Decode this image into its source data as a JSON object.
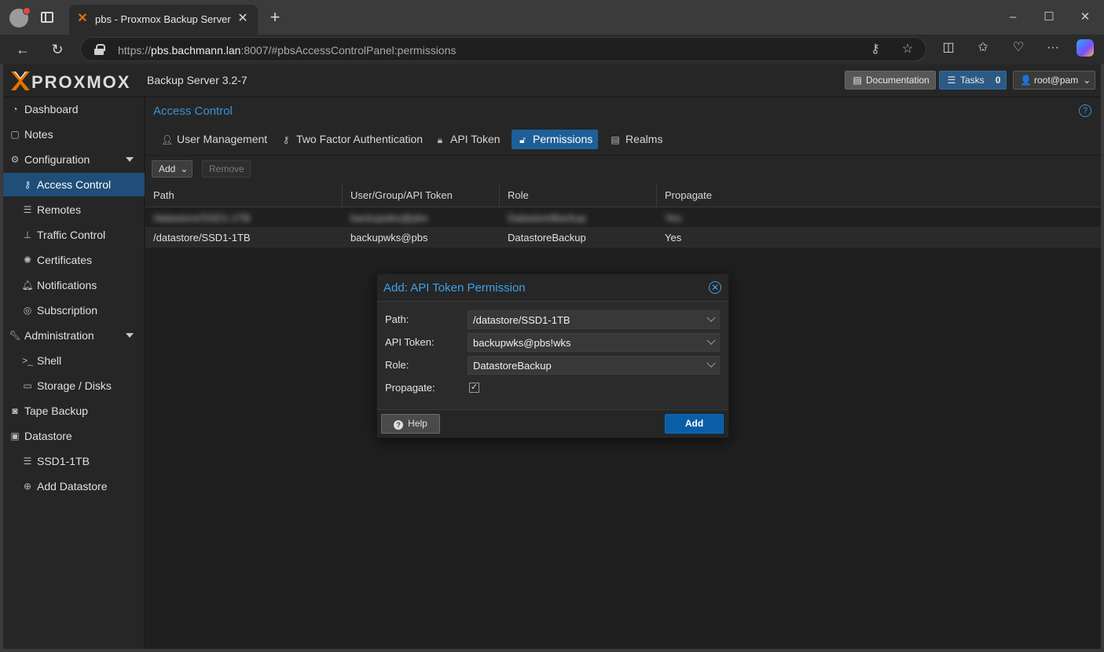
{
  "browser": {
    "tab_title": "pbs - Proxmox Backup Server",
    "url_prefix": "https://",
    "url_host": "pbs.bachmann.lan",
    "url_rest": ":8007/#pbsAccessControlPanel:permissions"
  },
  "header": {
    "logo_text": "PROXMOX",
    "product": "Backup Server 3.2-7",
    "documentation_label": "Documentation",
    "tasks_label": "Tasks",
    "tasks_count": "0",
    "user_label": "root@pam"
  },
  "sidebar": {
    "items": [
      {
        "label": "Dashboard",
        "icon": "dashboard-icon"
      },
      {
        "label": "Notes",
        "icon": "notes-icon"
      },
      {
        "label": "Configuration",
        "icon": "gears-icon"
      },
      {
        "label": "Access Control",
        "icon": "key-icon"
      },
      {
        "label": "Remotes",
        "icon": "server-icon"
      },
      {
        "label": "Traffic Control",
        "icon": "traffic-icon"
      },
      {
        "label": "Certificates",
        "icon": "certificate-icon"
      },
      {
        "label": "Notifications",
        "icon": "bell-icon"
      },
      {
        "label": "Subscription",
        "icon": "lifebuoy-icon"
      },
      {
        "label": "Administration",
        "icon": "wrench-icon"
      },
      {
        "label": "Shell",
        "icon": "terminal-icon"
      },
      {
        "label": "Storage / Disks",
        "icon": "hdd-icon"
      },
      {
        "label": "Tape Backup",
        "icon": "tape-icon"
      },
      {
        "label": "Datastore",
        "icon": "archive-icon"
      },
      {
        "label": "SSD1-1TB",
        "icon": "database-icon"
      },
      {
        "label": "Add Datastore",
        "icon": "plus-circle-icon"
      }
    ]
  },
  "panel": {
    "title": "Access Control",
    "tabs": [
      {
        "label": "User Management",
        "icon": "user-icon"
      },
      {
        "label": "Two Factor Authentication",
        "icon": "key-icon"
      },
      {
        "label": "API Token",
        "icon": "lock-icon"
      },
      {
        "label": "Permissions",
        "icon": "unlock-icon"
      },
      {
        "label": "Realms",
        "icon": "address-book-icon"
      }
    ],
    "toolbar": {
      "add_label": "Add",
      "remove_label": "Remove"
    },
    "columns": [
      "Path",
      "User/Group/API Token",
      "Role",
      "Propagate"
    ],
    "rows": [
      {
        "path": "/datastore/SSD1-1TB",
        "user": "backupwks@pbs",
        "role": "DatastoreBackup",
        "propagate": "Yes",
        "blurred": true
      },
      {
        "path": "/datastore/SSD1-1TB",
        "user": "backupwks@pbs",
        "role": "DatastoreBackup",
        "propagate": "Yes",
        "blurred": false
      }
    ]
  },
  "dialog": {
    "title": "Add: API Token Permission",
    "path_label": "Path:",
    "path_value": "/datastore/SSD1-1TB",
    "token_label": "API Token:",
    "token_value": "backupwks@pbs!wks",
    "role_label": "Role:",
    "role_value": "DatastoreBackup",
    "propagate_label": "Propagate:",
    "propagate_checked": true,
    "help_label": "Help",
    "add_label": "Add"
  },
  "colors": {
    "accent": "#3892d4",
    "selected_nav": "#1f4e78",
    "primary_button": "#0a5ea8",
    "brand_orange": "#e57000"
  }
}
